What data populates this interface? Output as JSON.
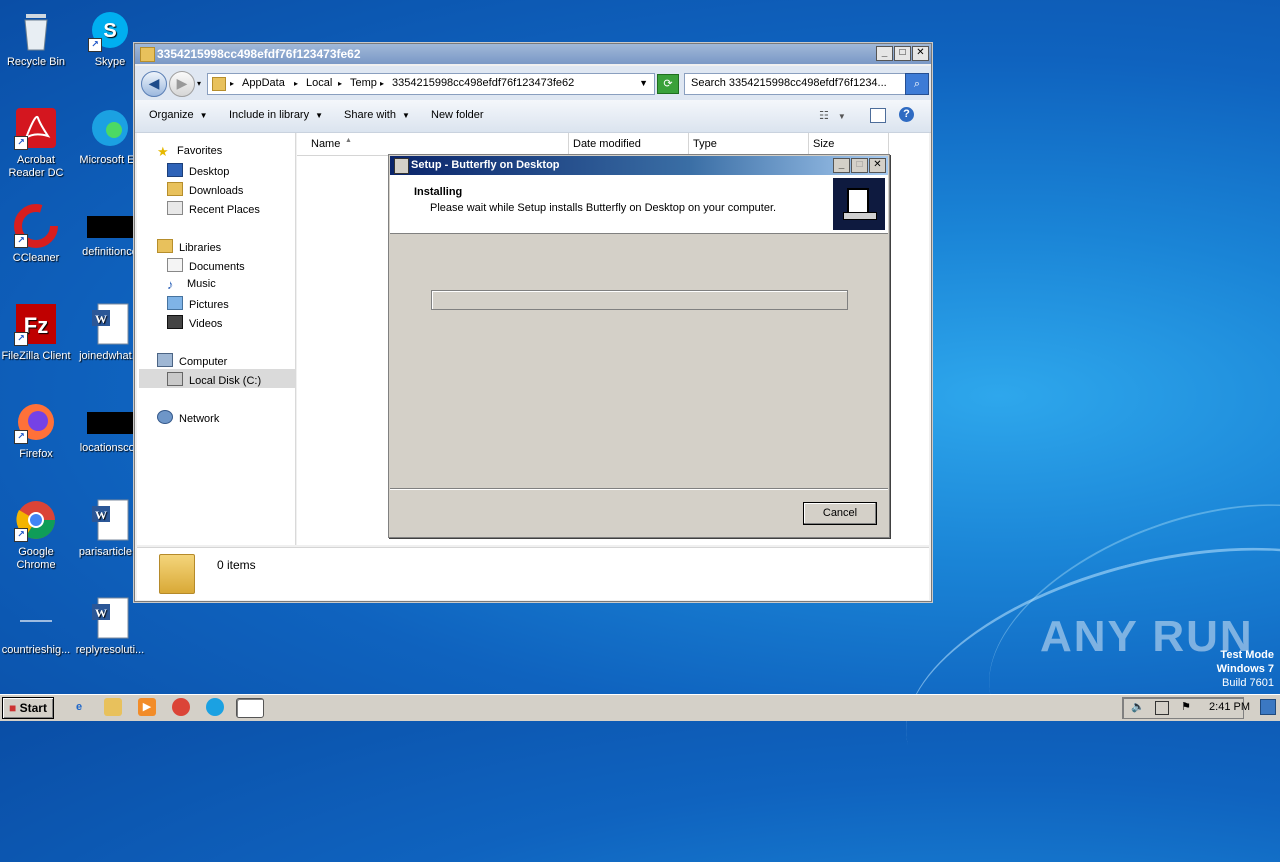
{
  "desktop": {
    "icons": [
      {
        "label": "Recycle Bin"
      },
      {
        "label": "Skype"
      },
      {
        "label": "Acrobat Reader DC"
      },
      {
        "label": "Microsoft Ed"
      },
      {
        "label": "CCleaner"
      },
      {
        "label": "definitionco"
      },
      {
        "label": "FileZilla Client"
      },
      {
        "label": "joinedwhat..."
      },
      {
        "label": "Firefox"
      },
      {
        "label": "locationscos"
      },
      {
        "label": "Google Chrome"
      },
      {
        "label": "parisarticle..."
      },
      {
        "label": "countrieshig..."
      },
      {
        "label": "replyresoluti..."
      }
    ]
  },
  "explorer": {
    "title": "3354215998cc498efdf76f123473fe62",
    "breadcrumbs": [
      "AppData",
      "Local",
      "Temp",
      "3354215998cc498efdf76f123473fe62"
    ],
    "search_placeholder": "Search 3354215998cc498efdf76f1234...",
    "toolbar": {
      "organize": "Organize",
      "include": "Include in library",
      "share": "Share with",
      "new_folder": "New folder"
    },
    "nav": {
      "favorites": "Favorites",
      "desktop": "Desktop",
      "downloads": "Downloads",
      "recent": "Recent Places",
      "libraries": "Libraries",
      "documents": "Documents",
      "music": "Music",
      "pictures": "Pictures",
      "videos": "Videos",
      "computer": "Computer",
      "local_disk": "Local Disk (C:)",
      "network": "Network"
    },
    "columns": {
      "name": "Name",
      "date": "Date modified",
      "type": "Type",
      "size": "Size"
    },
    "status": "0 items"
  },
  "setup": {
    "title": "Setup - Butterfly on Desktop",
    "heading": "Installing",
    "subheading": "Please wait while Setup installs Butterfly on Desktop on your computer.",
    "progress": 0,
    "cancel": "Cancel"
  },
  "watermark": {
    "brand": "ANY RUN",
    "line1": "Test Mode",
    "line2": "Windows 7",
    "line3": "Build 7601"
  },
  "taskbar": {
    "start": "Start",
    "clock": "2:41 PM"
  }
}
